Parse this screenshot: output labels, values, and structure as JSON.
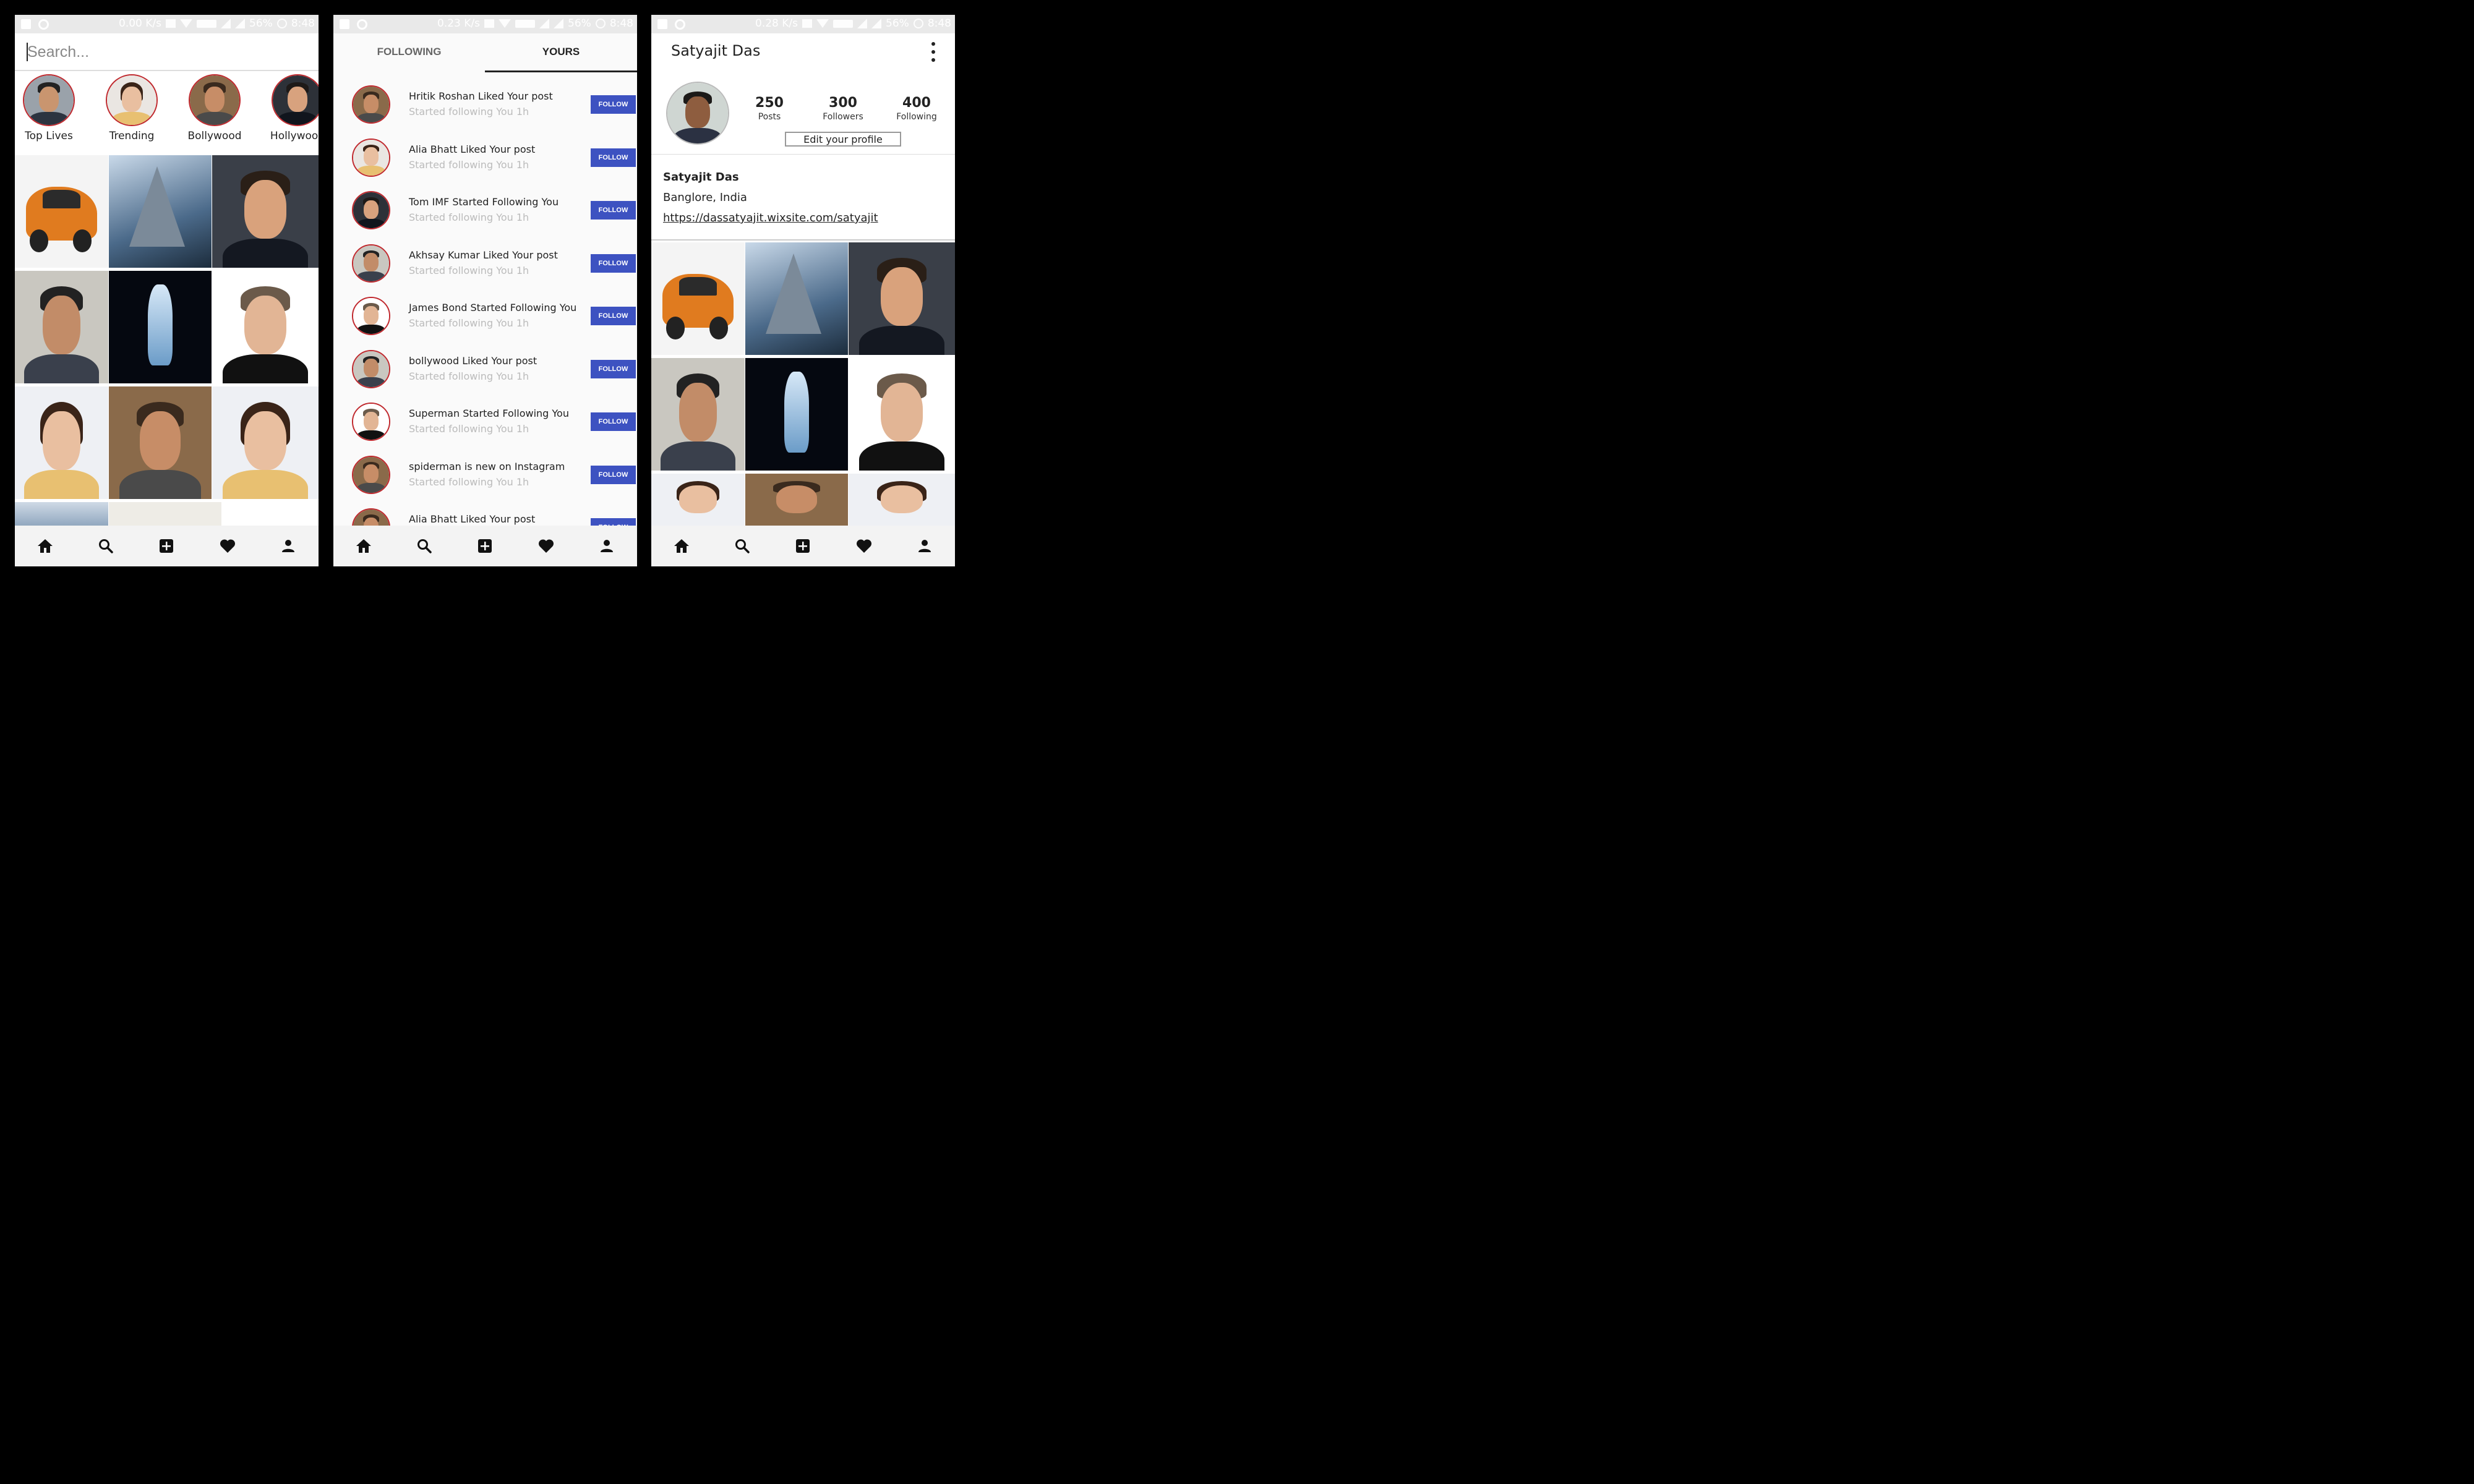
{
  "status_bars": [
    {
      "speed": "0.00 K/s",
      "battery": "56%",
      "time": "8:48"
    },
    {
      "speed": "0.23 K/s",
      "battery": "56%",
      "time": "8:48"
    },
    {
      "speed": "0.28 K/s",
      "battery": "56%",
      "time": "8:48"
    }
  ],
  "explore": {
    "search_placeholder": "Search...",
    "stories": [
      "Top Lives",
      "Trending",
      "Bollywood",
      "Hollywood"
    ]
  },
  "activity": {
    "tabs": [
      "FOLLOWING",
      "YOURS"
    ],
    "active_tab": "YOURS",
    "follow_label": "FOLLOW",
    "items": [
      {
        "title": "Hritik Roshan Liked Your post",
        "sub": "Started following You  1h"
      },
      {
        "title": "Alia Bhatt Liked Your post",
        "sub": "Started following You  1h"
      },
      {
        "title": "Tom IMF Started Following You",
        "sub": "Started following You  1h"
      },
      {
        "title": "Akhsay Kumar Liked Your post",
        "sub": "Started following You  1h"
      },
      {
        "title": "James Bond Started Following You",
        "sub": "Started following You  1h"
      },
      {
        "title": "bollywood Liked Your post",
        "sub": "Started following You  1h"
      },
      {
        "title": "Superman Started Following You",
        "sub": "Started following You  1h"
      },
      {
        "title": "spiderman is new on Instagram",
        "sub": "Started following You  1h"
      },
      {
        "title": "Alia Bhatt Liked Your post",
        "sub": ""
      }
    ]
  },
  "profile": {
    "name": "Satyajit Das",
    "posts": "250",
    "posts_label": "Posts",
    "followers": "300",
    "followers_label": "Followers",
    "following": "400",
    "following_label": "Following",
    "edit_label": "Edit your profile",
    "bio_name": "Satyajit Das",
    "location": "Banglore, India",
    "link": "https://dassatyajit.wixsite.com/satyajit"
  },
  "colors": {
    "accent": "#3d52c1",
    "story_ring": "#c0292e",
    "nav_bg": "#f3f3f3"
  },
  "nav_icons": [
    "home-icon",
    "search-icon",
    "add-icon",
    "heart-icon",
    "profile-icon"
  ]
}
